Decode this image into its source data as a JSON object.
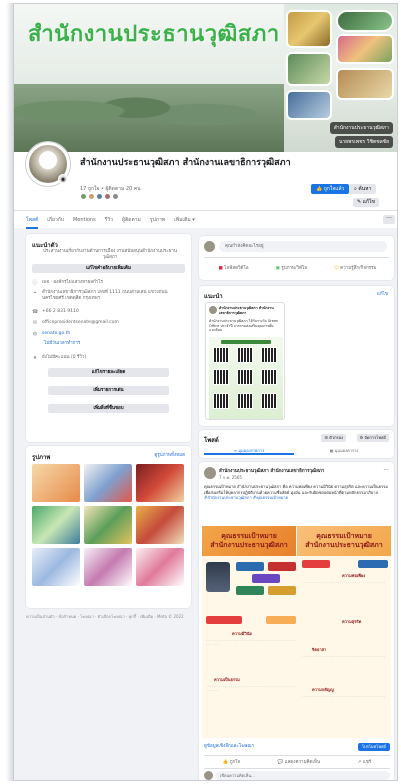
{
  "cover": {
    "title": "สำนักงานประธานวุฒิสภา",
    "badge_top": "สำนักงานประธานวุฒิสภา",
    "badge_bottom": "นายพรเพชร วิชิตชลชัย"
  },
  "profile": {
    "name": "สำนักงานประธานวุฒิสภา สำนักงานเลขาธิการวุฒิสภา",
    "meta": "17 ถูกใจ • ผู้ติดตาม 20 คน",
    "liked_label": "ถูกใจแล้ว",
    "search_label": "ค้นหา",
    "edit_label": "แก้ไข"
  },
  "tabs": {
    "items": [
      "โพสต์",
      "เกี่ยวกับ",
      "Mentions",
      "รีวิว",
      "ผู้ติดตาม",
      "รูปภาพ",
      "เพิ่มเติม ▾"
    ],
    "more": "···"
  },
  "intro": {
    "title": "แนะนำตัว",
    "description": "ประสานงานเกี่ยวกับงานด้านการเมือง งานสนับสนุนสำนักงานประธานวุฒิสภา",
    "edit_bio": "แก้ไขคำอธิบายเพิ่มเติม",
    "category": "เพจ · องค์กรไม่แสวงหาผลกำไร",
    "address": "สำนักงานเลขาธิการวุฒิสภา เลขที่ 1111 ถนนสามเสน แขวงถนนนครไชยศรี เขตดุสิต กรุงเทพฯ",
    "phone": "+66 2 831 9110",
    "email": "officepresidentsenate@gmail.com",
    "website": "senate.go.th",
    "service_hours": "ไม่มีวันเวลาทำการ",
    "rating": "ยังไม่มีคะแนน (0 รีวิว)",
    "btn_edit_details": "แก้ไขรายละเอียด",
    "btn_add_featured": "เพิ่มรายการเด่น",
    "btn_add_hobbies": "เพิ่มสิ่งที่ชื่นชอบ"
  },
  "photos": {
    "title": "รูปภาพ",
    "see_all": "ดูรูปภาพทั้งหมด"
  },
  "footer": {
    "text": "ความเป็นส่วนตัว · ข้อกำหนด · โฆษณา · ตัวเลือกโฆษณา · คุกกี้ · เพิ่มเติม · Meta © 2022"
  },
  "composer": {
    "placeholder": "คุณกำลังคิดอะไรอยู่",
    "live": "ไลฟ์สดวิดีโอ",
    "photo": "รูปภาพ/วิดีโอ",
    "feeling": "ความรู้สึก/กิจกรรม"
  },
  "featured": {
    "title": "แนะนำ",
    "edit": "แก้ไข",
    "post_author": "สำนักงานประธานวุฒิสภา สำนักงานเลขาธิการวุฒิสภา",
    "post_text": "สำนักงานประธานวุฒิสภา ได้รับรางวัล Green Office ประจำปี จากกรมส่งเสริมคุณภาพสิ่งแวดล้อม"
  },
  "posts": {
    "title": "โพสต์",
    "filter": "ตัวกรอง",
    "manage": "จัดการโพสต์",
    "list_view": "มุมมองรายการ",
    "grid_view": "มุมมองตาราง"
  },
  "post": {
    "author": "สำนักงานประธานวุฒิสภา สำนักงานเลขาธิการวุฒิสภา",
    "time": "7 ก.ค. 2565",
    "body": "คุณธรรมเป้าหมาย สำนักงานประธานวุฒิสภา คือ ความพอเพียง ความมีวินัย ความสุจริต และความเป็นธรรม เพื่อส่งเสริมให้บุคลากรปฏิบัติงานด้วยความซื่อสัตย์ มุ่งมั่น และรับผิดชอบต่อหน้าที่ตามหลักธรรมาภิบาล",
    "tags": "#สำนักงานประธานวุฒิสภา #คุณธรรมเป้าหมาย",
    "ig_title_left": "คุณธรรมเป้าหมาย สำนักงานประธานวุฒิสภา",
    "ig_title_right": "คุณธรรมเป้าหมาย สำนักงานประธานวุฒิสภา",
    "ig_labels": [
      "ความพอเพียง",
      "ความมีวินัย",
      "ความสุจริต",
      "ความเป็นธรรม",
      "จิตอาสา",
      "ความกตัญญู"
    ],
    "see_insights": "ดูข้อมูลเชิงลึกและโฆษณา",
    "boost": "โปรโมทโพสต์",
    "like": "ถูกใจ",
    "comment": "แสดงความคิดเห็น",
    "share": "แชร์",
    "comment_placeholder": "เขียนความคิดเห็น..."
  }
}
